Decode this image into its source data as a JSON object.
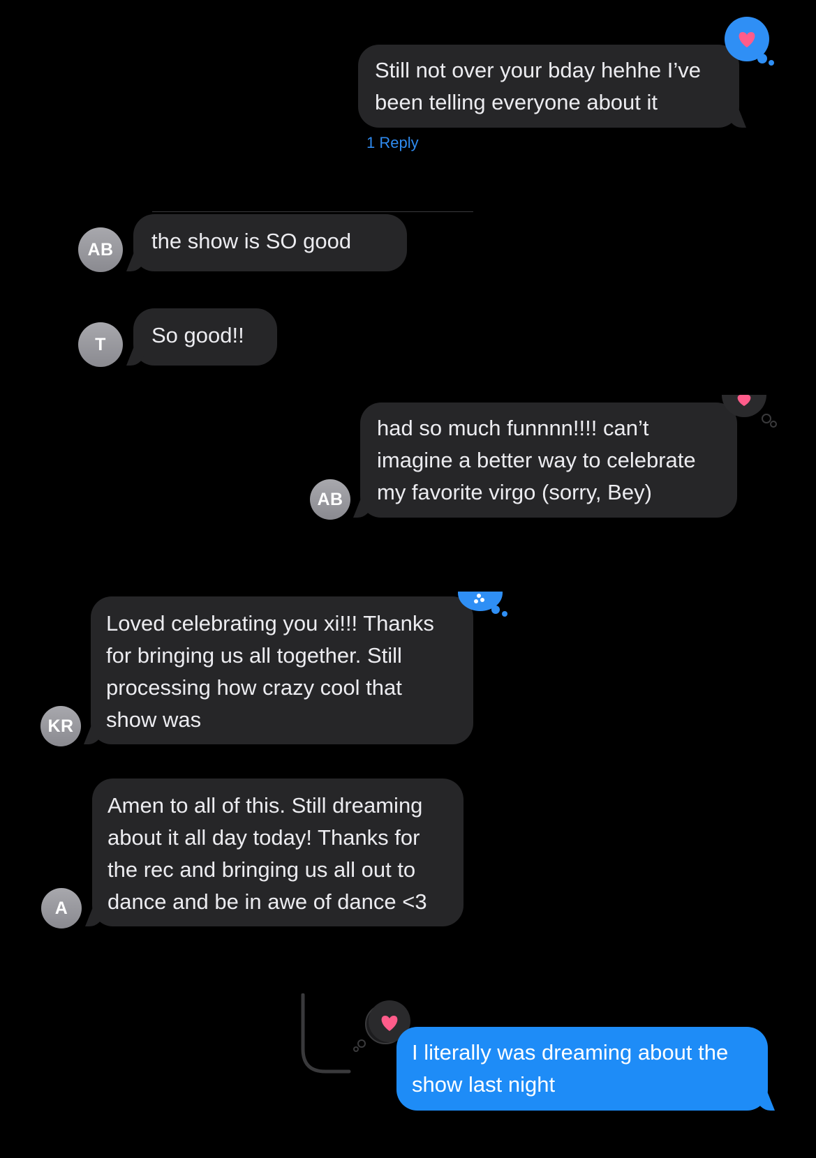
{
  "colors": {
    "background": "#000000",
    "incoming_bubble": "#262628",
    "outgoing_bubble": "#1e8cf7",
    "tapback_blue": "#2f8ff5",
    "tapback_dark": "#2a2a2c",
    "heart": "#ff5c8a",
    "link": "#2f8bf0"
  },
  "messages": [
    {
      "id": "m1",
      "text": "Still not over your bday hehhe I’ve\nbeen telling everyone about it",
      "reply_count_label": "1 Reply",
      "tapback": "heart-icon"
    },
    {
      "id": "m2",
      "sender_initials": "AB",
      "text": "the show is SO good"
    },
    {
      "id": "m3",
      "sender_initials": "T",
      "text": "So good!!"
    },
    {
      "id": "m4",
      "sender_initials": "AB",
      "text": "had so much funnnn!!!! can’t\nimagine a better way to celebrate\nmy favorite virgo (sorry, Bey)",
      "tapback": "heart-icon"
    },
    {
      "id": "m5",
      "sender_initials": "KR",
      "text": "Loved celebrating you xi!!! Thanks\nfor bringing us all together. Still\nprocessing how crazy cool that\nshow was",
      "tapback": "more-reactions-icon"
    },
    {
      "id": "m6",
      "sender_initials": "A",
      "text": "Amen to all of this. Still dreaming\nabout it all day today! Thanks for\nthe rec and bringing us all out to\ndance and be in awe of dance <3"
    },
    {
      "id": "m7",
      "text": "I literally was dreaming about the\nshow last night",
      "tapback": "heart-icon"
    }
  ]
}
